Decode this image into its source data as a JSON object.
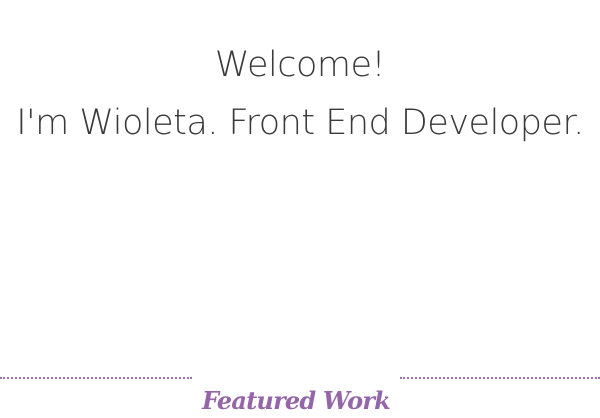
{
  "hero": {
    "greeting": "Welcome!",
    "intro": "I'm Wioleta. Front End Developer."
  },
  "featured": {
    "heading": "Featured Work"
  },
  "colors": {
    "text": "#3a3a3a",
    "accent": "#9466a8",
    "divider": "#9b72ad",
    "background": "#ffffff"
  }
}
